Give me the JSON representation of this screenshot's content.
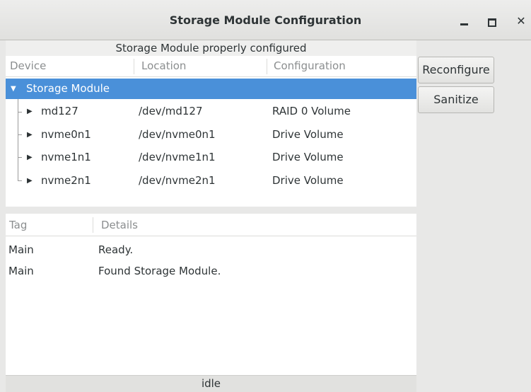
{
  "window": {
    "title": "Storage Module Configuration",
    "controls": {
      "minimize": "minimize-icon",
      "maximize": "maximize-icon",
      "close": "✕"
    }
  },
  "status_message": "Storage Module properly configured",
  "device_tree": {
    "columns": [
      "Device",
      "Location",
      "Configuration"
    ],
    "root": {
      "label": "Storage Module",
      "expanded": true,
      "selected": true
    },
    "children": [
      {
        "device": "md127",
        "location": "/dev/md127",
        "configuration": "RAID 0 Volume"
      },
      {
        "device": "nvme0n1",
        "location": "/dev/nvme0n1",
        "configuration": "Drive Volume"
      },
      {
        "device": "nvme1n1",
        "location": "/dev/nvme1n1",
        "configuration": "Drive Volume"
      },
      {
        "device": "nvme2n1",
        "location": "/dev/nvme2n1",
        "configuration": "Drive Volume"
      }
    ]
  },
  "buttons": {
    "reconfigure": "Reconfigure",
    "sanitize": "Sanitize"
  },
  "log": {
    "columns": [
      "Tag",
      "Details"
    ],
    "rows": [
      {
        "tag": "Main",
        "details": "Ready."
      },
      {
        "tag": "Main",
        "details": "Found Storage Module."
      }
    ]
  },
  "statusbar": "idle",
  "colors": {
    "selection": "#4a90d9",
    "background": "#e8e8e7"
  }
}
